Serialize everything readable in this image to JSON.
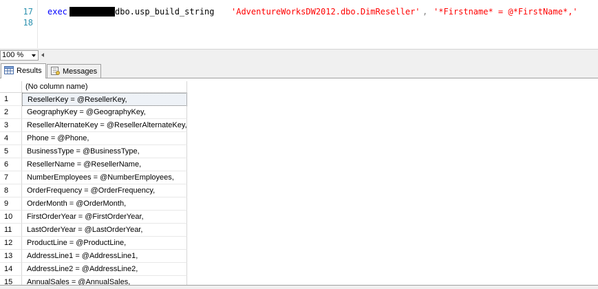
{
  "editor": {
    "lines": [
      {
        "number": "17"
      },
      {
        "number": "18",
        "exec": "exec",
        "object": "dbo.usp_build_string",
        "arg1": "'AdventureWorksDW2012.dbo.DimReseller'",
        "comma": ",",
        "arg2": "'*Firstname* = @*FirstName*,'"
      }
    ]
  },
  "zoom": {
    "value": "100 %"
  },
  "tabs": [
    {
      "label": "Results",
      "icon": "grid-icon",
      "active": true
    },
    {
      "label": "Messages",
      "icon": "messages-icon",
      "active": false
    }
  ],
  "results": {
    "column_header": "(No column name)",
    "rows": [
      {
        "n": "1",
        "value": "ResellerKey = @ResellerKey,"
      },
      {
        "n": "2",
        "value": "GeographyKey = @GeographyKey,"
      },
      {
        "n": "3",
        "value": "ResellerAlternateKey = @ResellerAlternateKey,"
      },
      {
        "n": "4",
        "value": "Phone = @Phone,"
      },
      {
        "n": "5",
        "value": "BusinessType = @BusinessType,"
      },
      {
        "n": "6",
        "value": "ResellerName = @ResellerName,"
      },
      {
        "n": "7",
        "value": "NumberEmployees = @NumberEmployees,"
      },
      {
        "n": "8",
        "value": "OrderFrequency = @OrderFrequency,"
      },
      {
        "n": "9",
        "value": "OrderMonth = @OrderMonth,"
      },
      {
        "n": "10",
        "value": "FirstOrderYear = @FirstOrderYear,"
      },
      {
        "n": "11",
        "value": "LastOrderYear = @LastOrderYear,"
      },
      {
        "n": "12",
        "value": "ProductLine = @ProductLine,"
      },
      {
        "n": "13",
        "value": "AddressLine1 = @AddressLine1,"
      },
      {
        "n": "14",
        "value": "AddressLine2 = @AddressLine2,"
      },
      {
        "n": "15",
        "value": "AnnualSales = @AnnualSales,"
      }
    ]
  }
}
